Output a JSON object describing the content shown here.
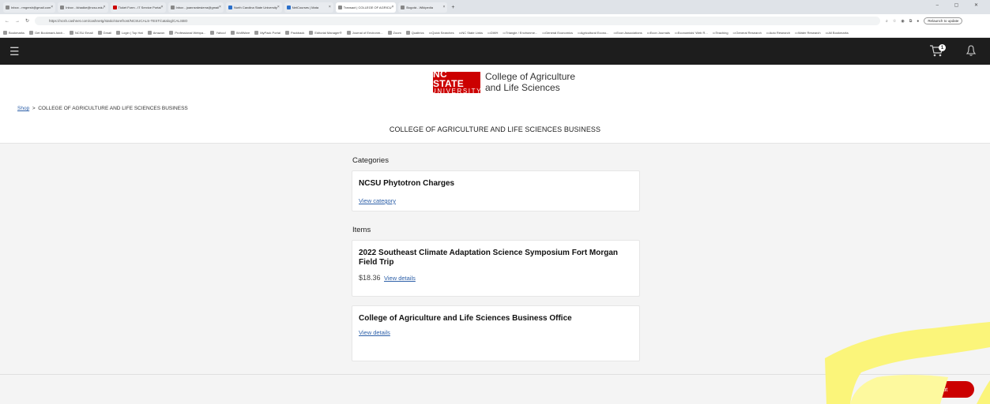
{
  "browser": {
    "tabs": [
      {
        "label": "Inbox - rmgersh@gmail.com",
        "active": false
      },
      {
        "label": "Inbox - ikhadke@ncsu.edu",
        "active": false
      },
      {
        "label": "Ticket Form - IT Service Portal",
        "active": false
      },
      {
        "label": "Inbox - joannsrdesierra@gmail",
        "active": false
      },
      {
        "label": "North Carolina State University",
        "active": false
      },
      {
        "label": "NetCourses | Mata",
        "active": false
      },
      {
        "label": "Transact | COLLEGE OF AGRICU",
        "active": true
      },
      {
        "label": "Bogotá - Wikipedia",
        "active": false
      }
    ],
    "new_tab": "+",
    "window_controls": "– ▢ ✕",
    "url": "https://ncsh.cashnet.com/cashnetg/static/storefront/NCSUCALS-TEST/catalog/CALSBO",
    "relaunch_label": "Relaunch to update",
    "bookmarks": [
      "Bookmarks",
      "Get Bookmark Addr...",
      "NCSU Email",
      "Gmail",
      "Login | Top Hat",
      "Amazon",
      "Professional Webpa...",
      "Yahoo!",
      "WolfWare",
      "MyPack Portal",
      "Packback",
      "Editorial Manager®",
      "Journal of Environm...",
      "Zoom",
      "Qualtrics",
      "Quick Searches",
      "NC State Links",
      "DWH",
      "Triangle / Environme...",
      "General Economics",
      "Agricultural Econo...",
      "Econ Associations",
      "Econ Journals",
      "Economists' Web R...",
      "Teaching",
      "General Research",
      "Auto Research",
      "Water Research",
      "All Bookmarks"
    ]
  },
  "header": {
    "cart_count": "1"
  },
  "logo": {
    "line1": "NC STATE",
    "line2": "UNIVERSITY",
    "college_line1": "College of Agriculture",
    "college_line2": "and Life Sciences",
    "brand_color": "#cc0000"
  },
  "breadcrumb": {
    "shop": "Shop",
    "separator": ">",
    "current": "COLLEGE OF AGRICULTURE AND LIFE SCIENCES BUSINESS"
  },
  "page_title": "COLLEGE OF AGRICULTURE AND LIFE SCIENCES BUSINESS",
  "categories": {
    "heading": "Categories",
    "items": [
      {
        "title": "NCSU Phytotron Charges",
        "link": "View category"
      }
    ]
  },
  "items": {
    "heading": "Items",
    "list": [
      {
        "title": "2022 Southeast Climate Adaptation Science Symposium Fort Morgan Field Trip",
        "price": "$18.36",
        "link": "View details"
      },
      {
        "title": "College of Agriculture and Life Sciences Business Office",
        "price": "",
        "link": "View details"
      }
    ]
  },
  "checkout_label": "Checkout",
  "highlight_color": "#fbf57a"
}
